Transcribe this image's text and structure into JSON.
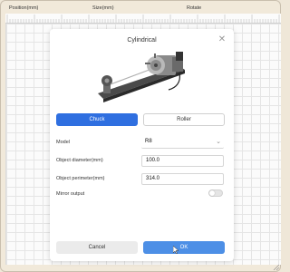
{
  "toolbar": {
    "position_label": "Position(mm)",
    "size_label": "Size(mm)",
    "rotate_label": "Rotate"
  },
  "dialog": {
    "title": "Cylindrical",
    "close_icon": "close-icon",
    "tabs": [
      {
        "label": "Chuck",
        "active": true
      },
      {
        "label": "Roller",
        "active": false
      }
    ],
    "model": {
      "label": "Model",
      "value": "R8"
    },
    "object_diameter": {
      "label": "Object diameter(mm)",
      "value": "100.0"
    },
    "object_perimeter": {
      "label": "Object perimeter(mm)",
      "value": "314.0"
    },
    "mirror_output": {
      "label": "Mirror output",
      "enabled": false
    },
    "cancel_label": "Cancel",
    "ok_label": "OK"
  },
  "colors": {
    "accent": "#2f6fe0",
    "ok_button": "#4d8fe6",
    "background": "#efe7d8"
  }
}
